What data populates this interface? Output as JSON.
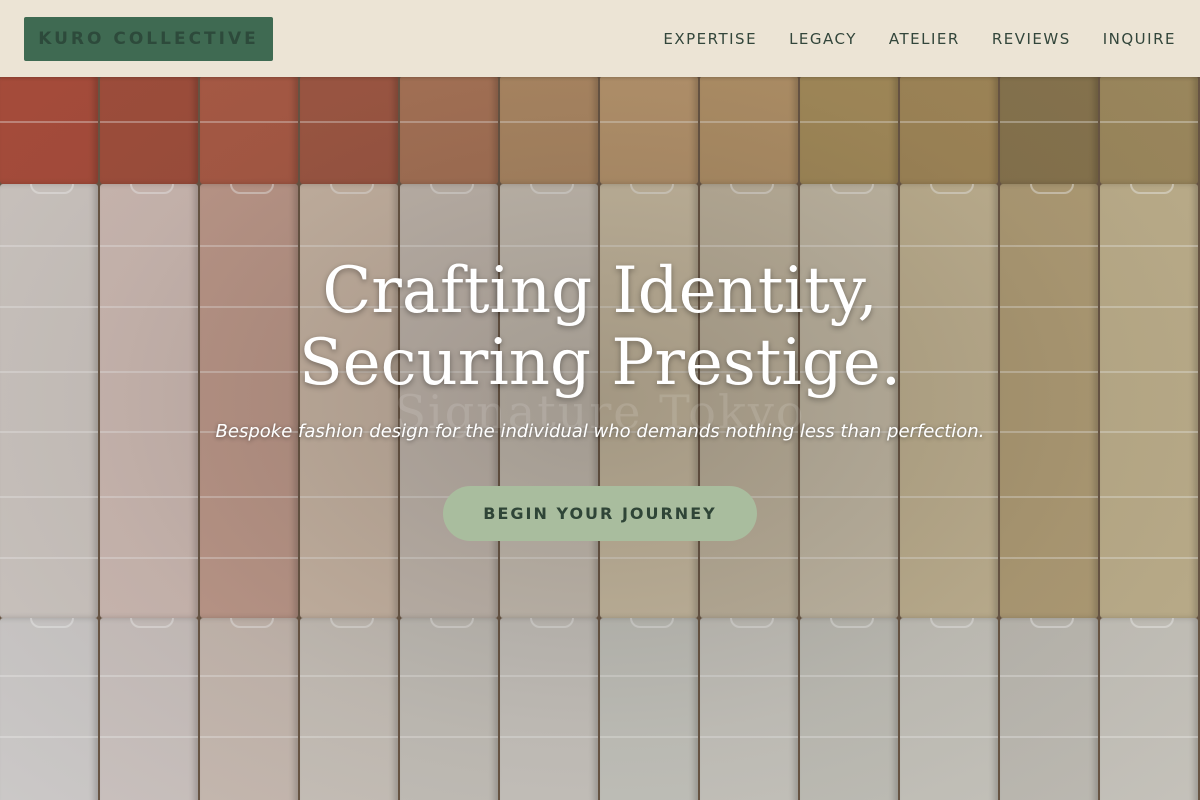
{
  "brand": {
    "logo_text": "KURO COLLECTIVE"
  },
  "nav": {
    "items": [
      {
        "label": "EXPERTISE"
      },
      {
        "label": "LEGACY"
      },
      {
        "label": "ATELIER"
      },
      {
        "label": "REVIEWS"
      },
      {
        "label": "INQUIRE"
      }
    ]
  },
  "hero": {
    "headline_line1": "Crafting Identity,",
    "headline_line2": "Securing Prestige.",
    "ghost_text": "Signature Tokyo",
    "subheadline": "Bespoke fashion design for the individual who demands nothing less than perfection.",
    "cta_label": "BEGIN YOUR JOURNEY"
  },
  "colors": {
    "header_bg": "#ece4d5",
    "logo_bg": "#3f6a52",
    "nav_text": "#33463b",
    "cta_bg": "#a9bd9e",
    "cta_text": "#2f4537",
    "swatch_row1": [
      "#b0503e",
      "#a8523f",
      "#b35f49",
      "#a85c47",
      "#b27a5c",
      "#b8916a",
      "#c29e74",
      "#bc9a6e",
      "#ad935f",
      "#a98e5d",
      "#8e7a52",
      "#a48f62"
    ],
    "swatch_row2": [
      "#d7d0cb",
      "#d8c4bd",
      "#c9a293",
      "#d6c2b0",
      "#d0c5bb",
      "#d4cbbf",
      "#d6c8ad",
      "#ccc0a9",
      "#cfc5b0",
      "#cbbc9a",
      "#b9a57c",
      "#c7b893"
    ],
    "swatch_row3": [
      "#d6d3d2",
      "#d5ccc9",
      "#d2c4bb",
      "#d3ccc4",
      "#cfcbc4",
      "#d3cfc9",
      "#cfcfc8",
      "#d2d0c9",
      "#cbcac2",
      "#d0cec6",
      "#c7c4bc",
      "#cfccc4"
    ]
  }
}
